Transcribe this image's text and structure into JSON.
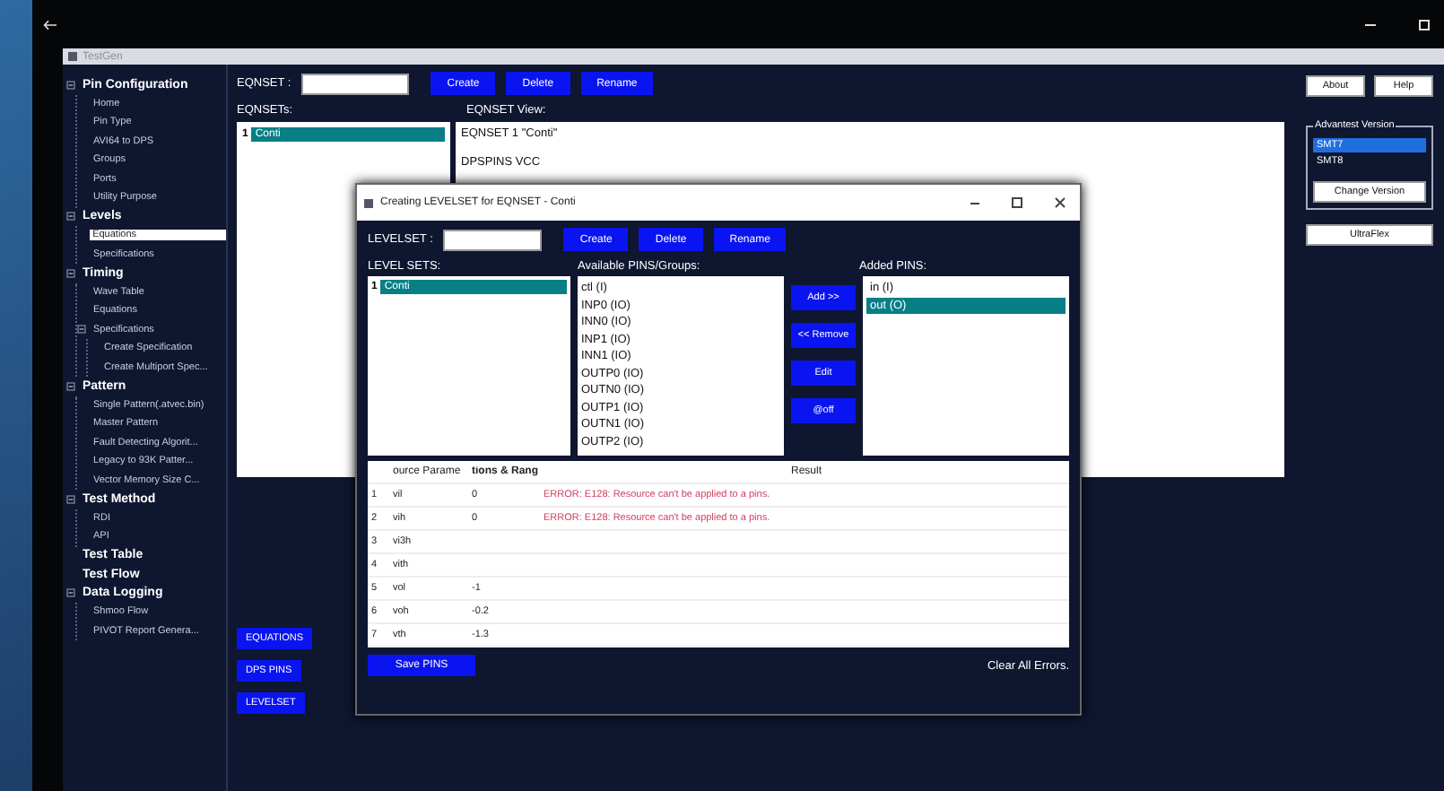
{
  "window": {
    "title": "TestGen"
  },
  "sidebar": {
    "items": [
      {
        "label": "Pin Configuration",
        "expanded": true,
        "selected": false,
        "children": [
          {
            "label": "Home",
            "selected": false
          },
          {
            "label": "Pin Type",
            "selected": false
          },
          {
            "label": "AVI64 to DPS",
            "selected": false
          },
          {
            "label": "Groups",
            "selected": false
          },
          {
            "label": "Ports",
            "selected": false
          },
          {
            "label": "Utility Purpose",
            "selected": false
          }
        ]
      },
      {
        "label": "Levels",
        "expanded": true,
        "selected": false,
        "children": [
          {
            "label": "Equations",
            "selected": true
          },
          {
            "label": "Specifications",
            "selected": false
          }
        ]
      },
      {
        "label": "Timing",
        "expanded": true,
        "selected": false,
        "children": [
          {
            "label": "Wave Table",
            "selected": false
          },
          {
            "label": "Equations",
            "selected": false
          },
          {
            "label": "Specifications",
            "expanded": true,
            "selected": false,
            "children": [
              {
                "label": "Create Specification",
                "selected": false
              },
              {
                "label": "Create Multiport Spec...",
                "selected": false
              }
            ]
          }
        ]
      },
      {
        "label": "Pattern",
        "expanded": true,
        "selected": false,
        "children": [
          {
            "label": "Single Pattern(.atvec.bin)",
            "selected": false
          },
          {
            "label": "Master Pattern",
            "selected": false
          },
          {
            "label": "Fault Detecting Algorit...",
            "selected": false
          },
          {
            "label": "Legacy to 93K Patter...",
            "selected": false
          },
          {
            "label": "Vector Memory Size C...",
            "selected": false
          }
        ]
      },
      {
        "label": "Test Method",
        "expanded": true,
        "selected": false,
        "children": [
          {
            "label": "RDI",
            "selected": false
          },
          {
            "label": "API",
            "selected": false
          }
        ]
      },
      {
        "label": "Test Table",
        "selected": false
      },
      {
        "label": "Test Flow",
        "selected": false
      },
      {
        "label": "Data Logging",
        "expanded": true,
        "selected": false,
        "children": [
          {
            "label": "Shmoo Flow",
            "selected": false
          },
          {
            "label": "PIVOT Report Genera...",
            "selected": false
          }
        ]
      }
    ]
  },
  "eqnset": {
    "label": "EQNSET :",
    "buttons": [
      "Create",
      "Delete",
      "Rename"
    ],
    "list_label": "EQNSETs:",
    "list": [
      {
        "index": "1",
        "name": "Conti",
        "selected": true
      }
    ],
    "view_label": "EQNSET View:",
    "view_lines": [
      "EQNSET 1 \"Conti\"",
      "DPSPINS VCC"
    ]
  },
  "side_buttons": [
    "EQUATIONS",
    "DPS PINS",
    "LEVELSET"
  ],
  "right_panel": {
    "buttons": [
      "About",
      "Help"
    ],
    "version_group": "Advantest Version",
    "versions": [
      {
        "label": "SMT7",
        "selected": true
      },
      {
        "label": "SMT8",
        "selected": false
      }
    ],
    "change_button": "Change Version",
    "ultraflex_button": "UltraFlex"
  },
  "dialog": {
    "title": "Creating LEVELSET for EQNSET - Conti",
    "levelset_label": "LEVELSET :",
    "buttons": [
      "Create",
      "Delete",
      "Rename"
    ],
    "level_sets_label": "LEVEL SETS:",
    "level_sets": [
      {
        "index": "1",
        "name": "Conti",
        "selected": true
      }
    ],
    "available_label": "Available PINS/Groups:",
    "available": [
      "ctl (I)",
      "INP0 (IO)",
      "INN0 (IO)",
      "INP1 (IO)",
      "INN1 (IO)",
      "OUTP0 (IO)",
      "OUTN0 (IO)",
      "OUTP1 (IO)",
      "OUTN1 (IO)",
      "OUTP2 (IO)"
    ],
    "move_buttons": [
      "Add >>",
      "<< Remove",
      "Edit",
      "@off"
    ],
    "added_label": "Added PINS:",
    "added": [
      {
        "label": "in (I)",
        "selected": false
      },
      {
        "label": "out (O)",
        "selected": true
      }
    ],
    "table": {
      "columns": [
        "ource Parame",
        "tions & Rang",
        "Result"
      ],
      "rows": [
        {
          "index": "1",
          "parameter": "vil",
          "value": "0",
          "result": "ERROR: E128: Resource can't be applied to a pins."
        },
        {
          "index": "2",
          "parameter": "vih",
          "value": "0",
          "result": "ERROR: E128: Resource can't be applied to a pins."
        },
        {
          "index": "3",
          "parameter": "vi3h"
        },
        {
          "index": "4",
          "parameter": "vith"
        },
        {
          "index": "5",
          "parameter": "vol",
          "value": "-1"
        },
        {
          "index": "6",
          "parameter": "voh",
          "value": "-0.2"
        },
        {
          "index": "7",
          "parameter": "vth",
          "value": "-1.3"
        }
      ]
    },
    "save_button": "Save PINS",
    "clear_link": "Clear All Errors."
  }
}
